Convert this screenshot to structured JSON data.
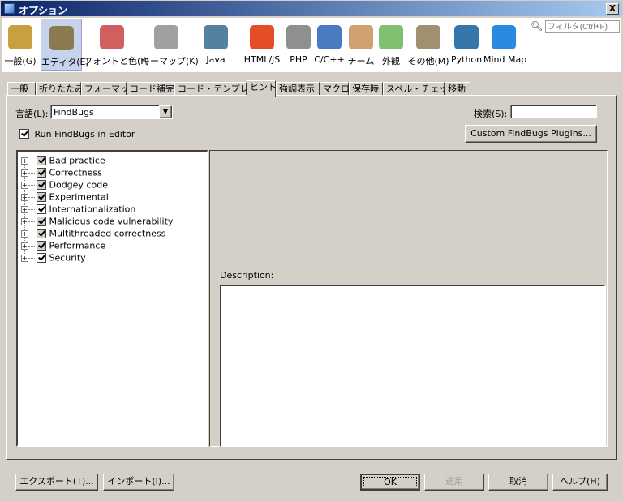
{
  "window": {
    "title": "オプション",
    "close_label": "X"
  },
  "toolbar": {
    "items": [
      {
        "label": "一般(G)",
        "icon": "general-wrench-gear-icon",
        "color": "#c8a040"
      },
      {
        "label": "エディタ(E)",
        "icon": "editor-book-pencil-icon",
        "color": "#8a7a50",
        "selected": true
      },
      {
        "label": "フォントと色(F)",
        "icon": "fonts-colors-icon",
        "color": "#d06060"
      },
      {
        "label": "キーマップ(K)",
        "icon": "keymap-keyboard-icon",
        "color": "#a0a0a0"
      },
      {
        "label": "Java",
        "icon": "java-icon",
        "color": "#5382a1"
      },
      {
        "label": "HTML/JS",
        "icon": "html5-icon",
        "color": "#e44d26"
      },
      {
        "label": "PHP",
        "icon": "php-icon",
        "color": "#8f8f8f"
      },
      {
        "label": "C/C++",
        "icon": "cpp-icon",
        "color": "#4a7ac0"
      },
      {
        "label": "チーム",
        "icon": "team-cubes-icon",
        "color": "#d0a070"
      },
      {
        "label": "外観",
        "icon": "appearance-layout-icon",
        "color": "#80c070"
      },
      {
        "label": "その他(M)",
        "icon": "misc-gear-folder-icon",
        "color": "#a09070"
      },
      {
        "label": "Python",
        "icon": "python-icon",
        "color": "#3776ab"
      },
      {
        "label": "Mind Map",
        "icon": "mindmap-icon",
        "color": "#2a8ae0"
      }
    ],
    "filter_placeholder": "フィルタ(Ctrl+F)"
  },
  "tabs": [
    {
      "label": "一般"
    },
    {
      "label": "折りたたみ"
    },
    {
      "label": "フォーマット"
    },
    {
      "label": "コード補完"
    },
    {
      "label": "コード・テンプレート"
    },
    {
      "label": "ヒント",
      "selected": true
    },
    {
      "label": "強調表示"
    },
    {
      "label": "マクロ"
    },
    {
      "label": "保存時"
    },
    {
      "label": "スペル・チェッカ"
    },
    {
      "label": "移動"
    }
  ],
  "hints": {
    "language_label": "言語(L):",
    "language_value": "FindBugs",
    "search_label": "検索(S):",
    "search_value": "",
    "run_in_editor_label": "Run FindBugs in Editor",
    "run_in_editor_checked": true,
    "custom_plugins_button": "Custom FindBugs Plugins...",
    "description_label": "Description:",
    "tree": [
      {
        "label": "Bad practice",
        "checked": true,
        "partial": true
      },
      {
        "label": "Correctness",
        "checked": true,
        "partial": true
      },
      {
        "label": "Dodgey code",
        "checked": true,
        "partial": true
      },
      {
        "label": "Experimental",
        "checked": true,
        "partial": true
      },
      {
        "label": "Internationalization",
        "checked": true,
        "partial": false
      },
      {
        "label": "Malicious code vulnerability",
        "checked": true,
        "partial": true
      },
      {
        "label": "Multithreaded correctness",
        "checked": true,
        "partial": true
      },
      {
        "label": "Performance",
        "checked": true,
        "partial": true
      },
      {
        "label": "Security",
        "checked": true,
        "partial": false
      }
    ]
  },
  "buttons": {
    "export": "エクスポート(T)...",
    "import": "インポート(I)...",
    "ok": "OK",
    "apply": "適用",
    "cancel": "取消",
    "help": "ヘルプ(H)"
  }
}
